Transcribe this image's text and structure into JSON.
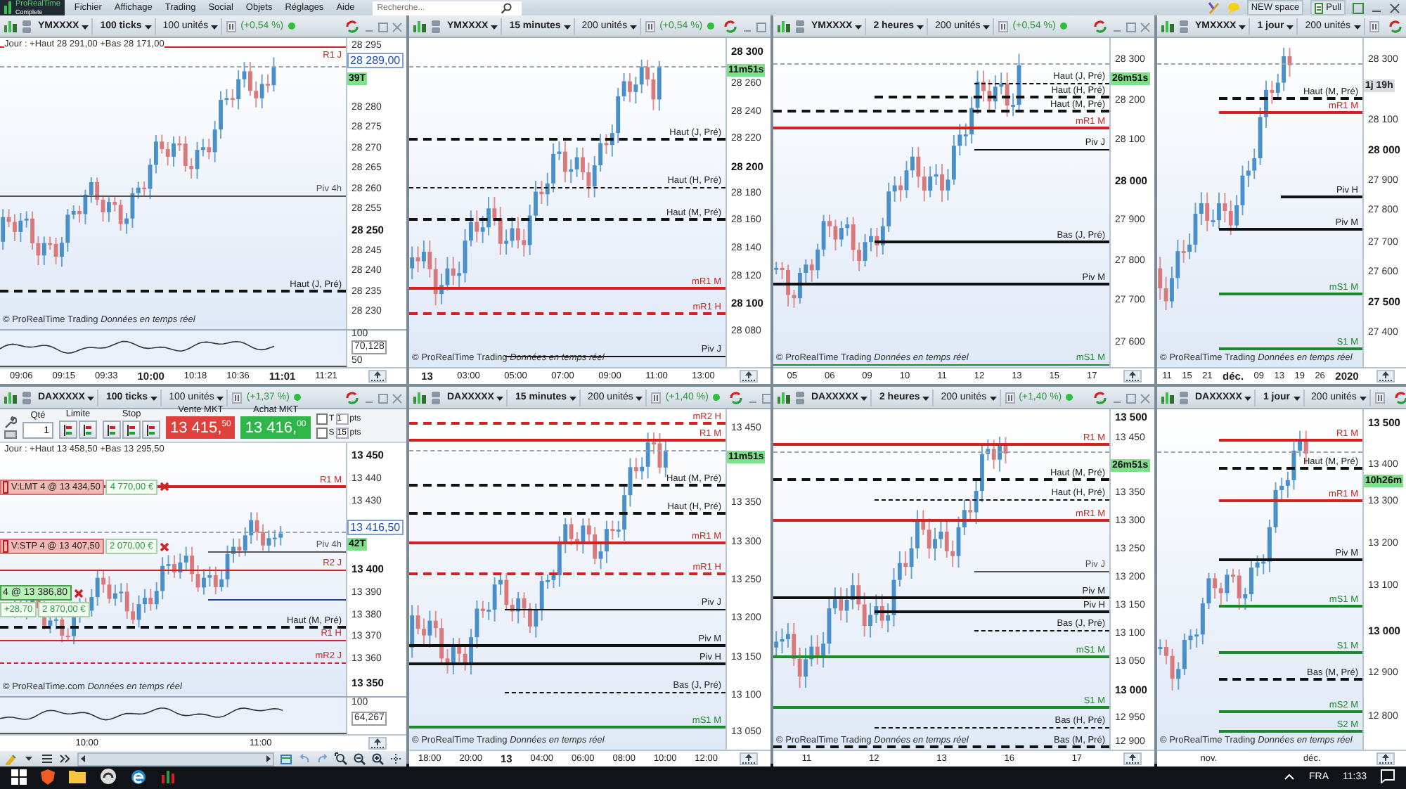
{
  "app": {
    "logo_title": "ProRealTime",
    "logo_subtitle": "Complete",
    "menu": [
      "Fichier",
      "Affichage",
      "Trading",
      "Social",
      "Objets",
      "Réglages",
      "Aide"
    ],
    "search": {
      "placeholder": "Recherche..."
    },
    "workspace": "NEW space",
    "pull": "Pull"
  },
  "panels": [
    {
      "instrument": "YMXXXX",
      "timeframe": "100 ticks",
      "units": "100 unités",
      "change": "(+0,54 %)",
      "info": "Jour : +Haut 28 291,00 +Bas 28 171,00",
      "note": "© ProRealTime Trading *Données en temps réel*",
      "ticks": [
        {
          "label": "28 295",
          "major": false
        },
        {
          "label": "28 280",
          "major": false
        },
        {
          "label": "28 275",
          "major": false
        },
        {
          "label": "28 270",
          "major": false
        },
        {
          "label": "28 265",
          "major": false
        },
        {
          "label": "28 260",
          "major": false
        },
        {
          "label": "28 255",
          "major": false
        },
        {
          "label": "28 250",
          "major": true
        },
        {
          "label": "28 245",
          "major": false
        },
        {
          "label": "28 240",
          "major": false
        },
        {
          "label": "28 235",
          "major": false
        },
        {
          "label": "28 230",
          "major": false
        }
      ],
      "badges": [
        {
          "text": "28 289,00",
          "kind": "price"
        },
        {
          "text": "39T",
          "kind": "countdown"
        }
      ],
      "lines": [
        {
          "kind": "price"
        },
        {
          "kind": "level",
          "label": "R1 J",
          "color": "#d42020",
          "dashed": false,
          "thick": false
        },
        {
          "kind": "level",
          "label": "Piv 4h",
          "color": "#555555",
          "dashed": false,
          "thick": false
        },
        {
          "kind": "level",
          "label": "Haut (J, Pré)",
          "color": "#111111",
          "dashed": true,
          "thick": true
        }
      ],
      "oscillator": {
        "labels": [
          {
            "text": "100",
            "boxed": false
          },
          {
            "text": "70,128",
            "boxed": true
          },
          {
            "text": "50",
            "boxed": false
          }
        ]
      },
      "xticks": [
        {
          "label": "09:06",
          "major": false
        },
        {
          "label": "09:15",
          "major": false
        },
        {
          "label": "09:33",
          "major": false
        },
        {
          "label": "10:00",
          "major": true
        },
        {
          "label": "10:18",
          "major": false
        },
        {
          "label": "10:36",
          "major": false
        },
        {
          "label": "11:01",
          "major": true
        },
        {
          "label": "11:21",
          "major": false
        }
      ]
    },
    {
      "instrument": "YMXXXX",
      "timeframe": "15 minutes",
      "units": "200 unités",
      "change": "(+0,54 %)",
      "note": "© ProRealTime Trading *Données en temps réel*",
      "ticks": [
        {
          "label": "28 300",
          "major": true
        },
        {
          "label": "28 260",
          "major": false
        },
        {
          "label": "28 240",
          "major": false
        },
        {
          "label": "28 220",
          "major": false
        },
        {
          "label": "28 200",
          "major": true
        },
        {
          "label": "28 180",
          "major": false
        },
        {
          "label": "28 160",
          "major": false
        },
        {
          "label": "28 140",
          "major": false
        },
        {
          "label": "28 120",
          "major": false
        },
        {
          "label": "28 100",
          "major": true
        },
        {
          "label": "28 080",
          "major": false
        }
      ],
      "badges": [
        {
          "text": "11m51s",
          "kind": "countdown"
        }
      ],
      "lines": [
        {
          "kind": "price"
        },
        {
          "kind": "level",
          "label": "Haut (J, Pré)",
          "color": "#111111",
          "dashed": true,
          "thick": true
        },
        {
          "kind": "level",
          "label": "Haut (H, Pré)",
          "color": "#111111",
          "dashed": true,
          "thick": false
        },
        {
          "kind": "level",
          "label": "Haut (M, Pré)",
          "color": "#111111",
          "dashed": true,
          "thick": true
        },
        {
          "kind": "level",
          "label": "mR1 M",
          "color": "#d42020",
          "dashed": false,
          "thick": true
        },
        {
          "kind": "level",
          "label": "mR1 H",
          "color": "#d42020",
          "dashed": true,
          "thick": true
        },
        {
          "kind": "level",
          "label": "Piv J",
          "color": "#111111",
          "dashed": false,
          "thick": false
        }
      ],
      "xticks": [
        {
          "label": "13",
          "major": true
        },
        {
          "label": "03:00",
          "major": false
        },
        {
          "label": "05:00",
          "major": false
        },
        {
          "label": "07:00",
          "major": false
        },
        {
          "label": "09:00",
          "major": false
        },
        {
          "label": "11:00",
          "major": false
        },
        {
          "label": "13:00",
          "major": false
        }
      ]
    },
    {
      "instrument": "YMXXXX",
      "timeframe": "2 heures",
      "units": "200 unités",
      "change": "(+0,54 %)",
      "note": "© ProRealTime Trading *Données en temps réel*",
      "ticks": [
        {
          "label": "28 300",
          "major": false
        },
        {
          "label": "28 200",
          "major": false
        },
        {
          "label": "28 100",
          "major": false
        },
        {
          "label": "28 000",
          "major": true
        },
        {
          "label": "27 900",
          "major": false
        },
        {
          "label": "27 800",
          "major": false
        },
        {
          "label": "27 700",
          "major": false
        },
        {
          "label": "27 600",
          "major": false
        }
      ],
      "badges": [
        {
          "text": "26m51s",
          "kind": "countdown"
        }
      ],
      "lines": [
        {
          "kind": "price"
        },
        {
          "kind": "level",
          "label": "Haut (J, Pré)",
          "color": "#111111",
          "dashed": true,
          "thick": false
        },
        {
          "kind": "level",
          "label": "Haut (H, Pré)",
          "color": "#111111",
          "dashed": true,
          "thick": true
        },
        {
          "kind": "level",
          "label": "Haut (M, Pré)",
          "color": "#111111",
          "dashed": true,
          "thick": true
        },
        {
          "kind": "level",
          "label": "mR1 M",
          "color": "#d42020",
          "dashed": false,
          "thick": true
        },
        {
          "kind": "level",
          "label": "Piv J",
          "color": "#111111",
          "dashed": false,
          "thick": false
        },
        {
          "kind": "level",
          "label": "Bas (J, Pré)",
          "color": "#111111",
          "dashed": false,
          "thick": true
        },
        {
          "kind": "level",
          "label": "Piv M",
          "color": "#111111",
          "dashed": false,
          "thick": true
        },
        {
          "kind": "level",
          "label": "mS1 M",
          "color": "#1a8a2a",
          "dashed": false,
          "thick": false
        }
      ],
      "xticks": [
        {
          "label": "05",
          "major": false
        },
        {
          "label": "06",
          "major": false
        },
        {
          "label": "09",
          "major": false
        },
        {
          "label": "10",
          "major": false
        },
        {
          "label": "11",
          "major": false
        },
        {
          "label": "12",
          "major": false
        },
        {
          "label": "13",
          "major": false
        },
        {
          "label": "15",
          "major": false
        },
        {
          "label": "17",
          "major": false
        }
      ]
    },
    {
      "instrument": "YMXXXX",
      "timeframe": "1 jour",
      "units": "200 unités",
      "note": "© ProRealTime Trading *Données en temps réel*",
      "ticks": [
        {
          "label": "28 300",
          "major": false
        },
        {
          "label": "28 100",
          "major": false
        },
        {
          "label": "28 000",
          "major": true
        },
        {
          "label": "27 900",
          "major": false
        },
        {
          "label": "27 800",
          "major": false
        },
        {
          "label": "27 700",
          "major": false
        },
        {
          "label": "27 600",
          "major": false
        },
        {
          "label": "27 500",
          "major": true
        },
        {
          "label": "27 400",
          "major": false
        }
      ],
      "badges": [
        {
          "text": "1j 19h",
          "kind": "timer"
        }
      ],
      "lines": [
        {
          "kind": "price"
        },
        {
          "kind": "level",
          "label": "Haut (M, Pré)",
          "color": "#111111",
          "dashed": true,
          "thick": true
        },
        {
          "kind": "level",
          "label": "mR1 M",
          "color": "#d42020",
          "dashed": false,
          "thick": true
        },
        {
          "kind": "level",
          "label": "Piv H",
          "color": "#111111",
          "dashed": false,
          "thick": true
        },
        {
          "kind": "level",
          "label": "Piv M",
          "color": "#111111",
          "dashed": false,
          "thick": true
        },
        {
          "kind": "level",
          "label": "mS1 M",
          "color": "#1a8a2a",
          "dashed": false,
          "thick": true
        },
        {
          "kind": "level",
          "label": "S1 M",
          "color": "#1a8a2a",
          "dashed": false,
          "thick": true
        }
      ],
      "xticks": [
        {
          "label": "11",
          "major": false
        },
        {
          "label": "15",
          "major": false
        },
        {
          "label": "21",
          "major": false
        },
        {
          "label": "déc.",
          "major": true
        },
        {
          "label": "09",
          "major": false
        },
        {
          "label": "13",
          "major": false
        },
        {
          "label": "19",
          "major": false
        },
        {
          "label": "26",
          "major": false
        },
        {
          "label": "2020",
          "major": true
        }
      ]
    },
    {
      "instrument": "DAXXXXX",
      "timeframe": "100 ticks",
      "units": "100 unités",
      "change": "(+1,37 %)",
      "info": "Jour : +Haut 13 458,50 +Bas 13 295,50",
      "note": "© ProRealTime.com *Données en temps réel*",
      "order_bar": {
        "qty_label": "Qté",
        "qty": "1",
        "limit_label": "Limite",
        "stop_label": "Stop",
        "sell_label": "Vente MKT",
        "sell_price": "13 415,$^{50}$",
        "buy_label": "Achat MKT",
        "buy_price": "13 416,$^{00}$",
        "toggles": [
          {
            "label": "T",
            "checked": false,
            "value": "1",
            "unit": "pts"
          },
          {
            "label": "S",
            "checked": false,
            "value": "15",
            "unit": "pts"
          }
        ]
      },
      "ticks": [
        {
          "label": "13 450",
          "major": true
        },
        {
          "label": "13 440",
          "major": false
        },
        {
          "label": "13 430",
          "major": false
        },
        {
          "label": "13 400",
          "major": true
        },
        {
          "label": "13 390",
          "major": false
        },
        {
          "label": "13 380",
          "major": false
        },
        {
          "label": "13 370",
          "major": false
        },
        {
          "label": "13 360",
          "major": false
        },
        {
          "label": "13 350",
          "major": true
        }
      ],
      "badges": [
        {
          "text": "13 416,50",
          "kind": "price"
        },
        {
          "text": "42T",
          "kind": "countdown"
        }
      ],
      "lines": [
        {
          "kind": "price"
        },
        {
          "kind": "level",
          "label": "R1 M",
          "color": "#d42020",
          "dashed": false,
          "thick": true
        },
        {
          "kind": "level",
          "label": "Piv 4h",
          "color": "#555555",
          "dashed": false,
          "thick": false
        },
        {
          "kind": "level",
          "label": "R2 J",
          "color": "#d42020",
          "dashed": false,
          "thick": false
        },
        {
          "kind": "level",
          "color": "#1f3fa0",
          "dashed": false,
          "thick": false
        },
        {
          "kind": "level",
          "label": "Haut (M, Pré)",
          "color": "#111111",
          "dashed": true,
          "thick": true
        },
        {
          "kind": "level",
          "label": "R1 H",
          "color": "#d42020",
          "dashed": false,
          "thick": false
        },
        {
          "kind": "level",
          "label": "mR2 J",
          "color": "#d42020",
          "dashed": true,
          "thick": false
        }
      ],
      "orders": [
        {
          "kind": "limit",
          "label": "V:LMT  4 @ 13 434,50",
          "amount": "4 770,00 €"
        },
        {
          "kind": "stop",
          "label": "V:STP  4 @ 13 407,50",
          "amount": "2 070,00 €"
        },
        {
          "kind": "position",
          "label": "4 @ 13 386,80",
          "gain": "+28,70",
          "amount": "2 870,00 €"
        }
      ],
      "oscillator": {
        "labels": [
          {
            "text": "100",
            "boxed": false
          },
          {
            "text": "64,267",
            "boxed": true
          }
        ]
      },
      "xticks": [
        {
          "label": "10:00",
          "major": false
        },
        {
          "label": "11:00",
          "major": false
        }
      ],
      "toolbar": true
    },
    {
      "instrument": "DAXXXXX",
      "timeframe": "15 minutes",
      "units": "200 unités",
      "change": "(+1,40 %)",
      "note": "© ProRealTime Trading *Données en temps réel*",
      "ticks": [
        {
          "label": "13 450",
          "major": false
        },
        {
          "label": "13 350",
          "major": false
        },
        {
          "label": "13 300",
          "major": false
        },
        {
          "label": "13 250",
          "major": false
        },
        {
          "label": "13 200",
          "major": false
        },
        {
          "label": "13 150",
          "major": false
        },
        {
          "label": "13 100",
          "major": false
        },
        {
          "label": "13 050",
          "major": false
        }
      ],
      "badges": [
        {
          "text": "11m51s",
          "kind": "countdown"
        }
      ],
      "lines": [
        {
          "kind": "price"
        },
        {
          "kind": "level",
          "label": "mR2 H",
          "color": "#d42020",
          "dashed": true,
          "thick": true
        },
        {
          "kind": "level",
          "label": "R1 M",
          "color": "#d42020",
          "dashed": false,
          "thick": true
        },
        {
          "kind": "level",
          "label": "Haut (M, Pré)",
          "color": "#111111",
          "dashed": true,
          "thick": true
        },
        {
          "kind": "level",
          "label": "Haut (H, Pré)",
          "color": "#111111",
          "dashed": true,
          "thick": true
        },
        {
          "kind": "level",
          "label": "mR1 M",
          "color": "#d42020",
          "dashed": false,
          "thick": true
        },
        {
          "kind": "level",
          "label": "mR1 H",
          "color": "#d42020",
          "dashed": true,
          "thick": true
        },
        {
          "kind": "level",
          "label": "Piv J",
          "color": "#111111",
          "dashed": false,
          "thick": false
        },
        {
          "kind": "level",
          "label": "Piv M",
          "color": "#111111",
          "dashed": false,
          "thick": true
        },
        {
          "kind": "level",
          "label": "Piv H",
          "color": "#111111",
          "dashed": false,
          "thick": true
        },
        {
          "kind": "level",
          "label": "Bas (J, Pré)",
          "color": "#111111",
          "dashed": true,
          "thick": false
        },
        {
          "kind": "level",
          "label": "mS1 M",
          "color": "#1a8a2a",
          "dashed": false,
          "thick": true
        }
      ],
      "xticks": [
        {
          "label": "18:00",
          "major": false
        },
        {
          "label": "20:00",
          "major": false
        },
        {
          "label": "13",
          "major": true
        },
        {
          "label": "04:00",
          "major": false
        },
        {
          "label": "06:00",
          "major": false
        },
        {
          "label": "08:00",
          "major": false
        },
        {
          "label": "10:00",
          "major": false
        },
        {
          "label": "12:00",
          "major": false
        }
      ]
    },
    {
      "instrument": "DAXXXXX",
      "timeframe": "2 heures",
      "units": "200 unités",
      "change": "(+1,40 %)",
      "note": "© ProRealTime Trading *Données en temps réel*",
      "ticks": [
        {
          "label": "13 500",
          "major": true
        },
        {
          "label": "13 450",
          "major": false
        },
        {
          "label": "13 350",
          "major": false
        },
        {
          "label": "13 300",
          "major": false
        },
        {
          "label": "13 250",
          "major": false
        },
        {
          "label": "13 200",
          "major": false
        },
        {
          "label": "13 150",
          "major": false
        },
        {
          "label": "13 100",
          "major": false
        },
        {
          "label": "13 050",
          "major": false
        },
        {
          "label": "13 000",
          "major": true
        },
        {
          "label": "12 950",
          "major": false
        },
        {
          "label": "12 900",
          "major": false
        }
      ],
      "badges": [
        {
          "text": "26m51s",
          "kind": "countdown"
        }
      ],
      "lines": [
        {
          "kind": "price"
        },
        {
          "kind": "level",
          "label": "R1 M",
          "color": "#d42020",
          "dashed": false,
          "thick": true
        },
        {
          "kind": "level",
          "label": "Haut (M, Pré)",
          "color": "#111111",
          "dashed": true,
          "thick": true
        },
        {
          "kind": "level",
          "label": "Haut (H, Pré)",
          "color": "#111111",
          "dashed": true,
          "thick": false
        },
        {
          "kind": "level",
          "label": "mR1 M",
          "color": "#d42020",
          "dashed": false,
          "thick": true
        },
        {
          "kind": "level",
          "label": "Piv J",
          "color": "#555555",
          "dashed": false,
          "thick": false
        },
        {
          "kind": "level",
          "label": "Piv M",
          "color": "#111111",
          "dashed": false,
          "thick": true
        },
        {
          "kind": "level",
          "label": "Piv H",
          "color": "#111111",
          "dashed": false,
          "thick": true
        },
        {
          "kind": "level",
          "label": "Bas (J, Pré)",
          "color": "#111111",
          "dashed": true,
          "thick": false
        },
        {
          "kind": "level",
          "label": "mS1 M",
          "color": "#1a8a2a",
          "dashed": false,
          "thick": true
        },
        {
          "kind": "level",
          "label": "S1 M",
          "color": "#1a8a2a",
          "dashed": false,
          "thick": true
        },
        {
          "kind": "level",
          "label": "Bas (H, Pré)",
          "color": "#111111",
          "dashed": true,
          "thick": false
        },
        {
          "kind": "level",
          "label": "Bas (M, Pré)",
          "color": "#111111",
          "dashed": true,
          "thick": true
        }
      ],
      "xticks": [
        {
          "label": "11",
          "major": false
        },
        {
          "label": "12",
          "major": false
        },
        {
          "label": "13",
          "major": false
        },
        {
          "label": "16",
          "major": false
        },
        {
          "label": "17",
          "major": false
        }
      ]
    },
    {
      "instrument": "DAXXXXX",
      "timeframe": "1 jour",
      "units": "200 unités",
      "note": "© ProRealTime Trading *Données en temps réel*",
      "ticks": [
        {
          "label": "13 500",
          "major": true
        },
        {
          "label": "13 400",
          "major": false
        },
        {
          "label": "13 300",
          "major": false
        },
        {
          "label": "13 200",
          "major": false
        },
        {
          "label": "13 100",
          "major": false
        },
        {
          "label": "13 000",
          "major": true
        },
        {
          "label": "12 900",
          "major": false
        },
        {
          "label": "12 800",
          "major": false
        }
      ],
      "badges": [
        {
          "text": "10h26m",
          "kind": "countdown"
        }
      ],
      "lines": [
        {
          "kind": "price"
        },
        {
          "kind": "level",
          "label": "R1 M",
          "color": "#d42020",
          "dashed": false,
          "thick": true
        },
        {
          "kind": "level",
          "label": "Haut (M, Pré)",
          "color": "#111111",
          "dashed": true,
          "thick": true
        },
        {
          "kind": "level",
          "label": "mR1 M",
          "color": "#d42020",
          "dashed": false,
          "thick": true
        },
        {
          "kind": "level",
          "label": "Piv M",
          "color": "#111111",
          "dashed": false,
          "thick": true
        },
        {
          "kind": "level",
          "label": "mS1 M",
          "color": "#1a8a2a",
          "dashed": false,
          "thick": true
        },
        {
          "kind": "level",
          "label": "S1 M",
          "color": "#1a8a2a",
          "dashed": false,
          "thick": true
        },
        {
          "kind": "level",
          "label": "Bas (M, Pré)",
          "color": "#111111",
          "dashed": true,
          "thick": true
        },
        {
          "kind": "level",
          "label": "mS2 M",
          "color": "#1a8a2a",
          "dashed": false,
          "thick": true
        },
        {
          "kind": "level",
          "label": "S2 M",
          "color": "#1a8a2a",
          "dashed": false,
          "thick": true
        }
      ],
      "xticks": [
        {
          "label": "nov.",
          "major": false
        },
        {
          "label": "déc.",
          "major": false
        }
      ]
    }
  ],
  "taskbar": {
    "language": "FRA",
    "time": "11:33"
  }
}
